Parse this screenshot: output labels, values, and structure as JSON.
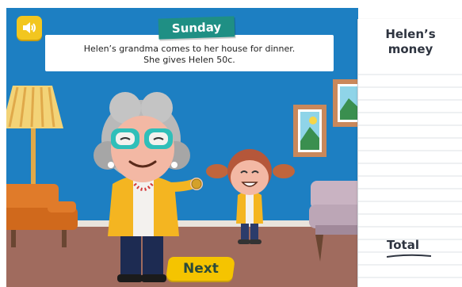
{
  "header": {
    "day_label": "Sunday",
    "story_line1": "Helen’s grandma comes to her house for dinner.",
    "story_line2": "She gives Helen 50c."
  },
  "controls": {
    "sound_icon": "speaker-icon",
    "next_label": "Next"
  },
  "notebook": {
    "title_line1": "Helen’s",
    "title_line2": "money",
    "total_label": "Total"
  },
  "colors": {
    "wall": "#1d7fc2",
    "floor": "#a06b5e",
    "day_tab": "#1f8f84",
    "button_yellow": "#f5c400"
  }
}
